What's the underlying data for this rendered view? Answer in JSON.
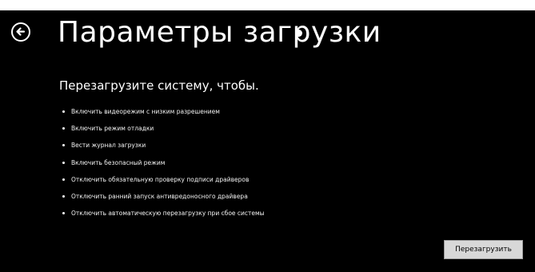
{
  "header": {
    "back_icon": "back-arrow-circle-icon",
    "title": "Параметры загрузки"
  },
  "main": {
    "subtitle": "Перезагрузите систему, чтобы.",
    "options": [
      "Включить видеорежим с низким разрешением",
      "Включить режим отладки",
      "Вести журнал загрузки",
      "Включить безопасный режим",
      "Отключить обязательную проверку подписи драйверов",
      "Отключить ранний запуск антивредоносного драйвера",
      "Отключить автоматическую перезагрузку при сбое системы"
    ]
  },
  "footer": {
    "restart_label": "Перезагрузить"
  },
  "colors": {
    "background": "#000000",
    "text": "#ffffff",
    "button_bg": "#d8d8d8"
  }
}
